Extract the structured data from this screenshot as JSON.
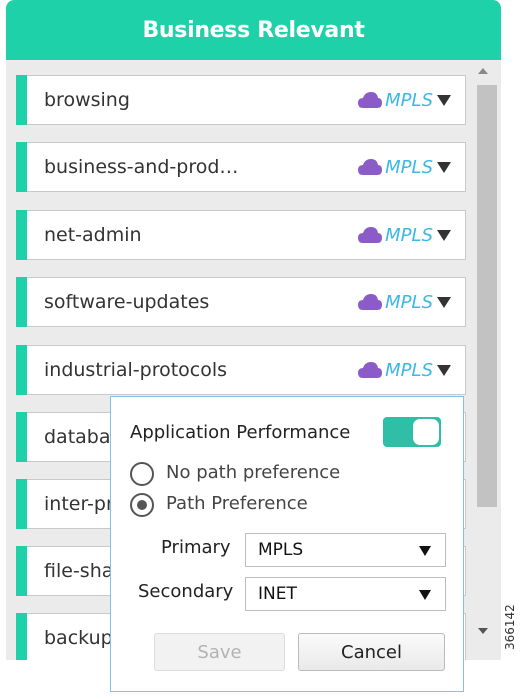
{
  "header": {
    "title": "Business Relevant"
  },
  "list": {
    "items": [
      {
        "name": "browsing",
        "path": "MPLS"
      },
      {
        "name": "business-and-prod…",
        "path": "MPLS"
      },
      {
        "name": "net-admin",
        "path": "MPLS"
      },
      {
        "name": "software-updates",
        "path": "MPLS"
      },
      {
        "name": "industrial-protocols",
        "path": "MPLS"
      },
      {
        "name": "databas",
        "path": ""
      },
      {
        "name": "inter-pr",
        "path": ""
      },
      {
        "name": "file-shar",
        "path": ""
      },
      {
        "name": "backup-",
        "path": ""
      }
    ]
  },
  "popup": {
    "title": "Application Performance",
    "toggle_on": true,
    "no_path_label": "No path preference",
    "path_pref_label": "Path Preference",
    "primary_label": "Primary",
    "primary_value": "MPLS",
    "secondary_label": "Secondary",
    "secondary_value": "INET",
    "save_label": "Save",
    "cancel_label": "Cancel"
  },
  "figure_id": "366142",
  "colors": {
    "accent": "#1fd1a8",
    "cloud": "#8b5cc7",
    "mpls_text": "#3cb8e6",
    "toggle": "#2fbfa6"
  }
}
